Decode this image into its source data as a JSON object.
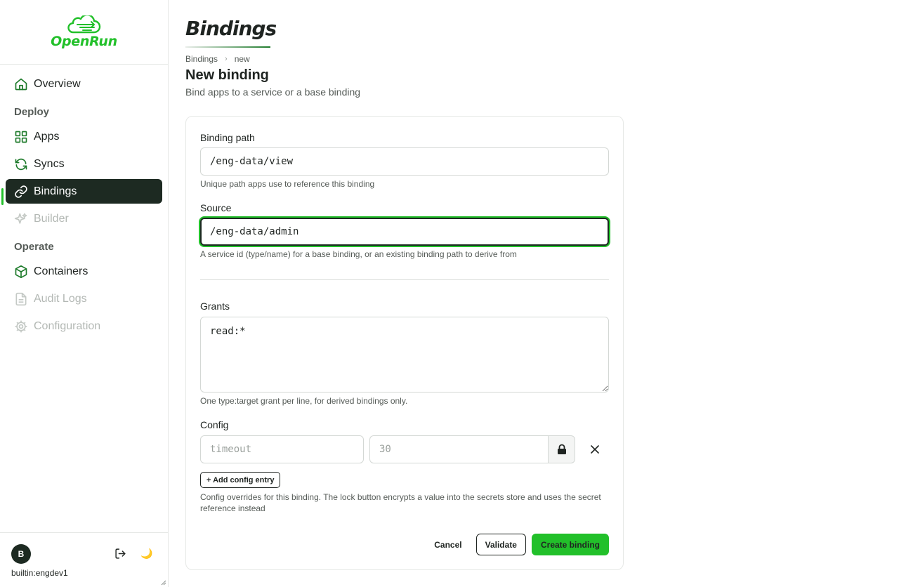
{
  "app": {
    "name": "OpenRun",
    "accent": "#22c02a",
    "dark": "#1d2a22"
  },
  "sidebar": {
    "items": [
      {
        "label": "Overview",
        "icon": "home-icon",
        "state": "normal"
      },
      {
        "label": "Apps",
        "icon": "grid-icon",
        "state": "normal"
      },
      {
        "label": "Syncs",
        "icon": "refresh-icon",
        "state": "normal"
      },
      {
        "label": "Bindings",
        "icon": "link-icon",
        "state": "active"
      },
      {
        "label": "Builder",
        "icon": "sparkle-icon",
        "state": "disabled"
      },
      {
        "label": "Containers",
        "icon": "cube-icon",
        "state": "normal"
      },
      {
        "label": "Audit Logs",
        "icon": "document-icon",
        "state": "disabled"
      },
      {
        "label": "Configuration",
        "icon": "gear-icon",
        "state": "disabled"
      }
    ],
    "sections": {
      "deploy": "Deploy",
      "operate": "Operate"
    },
    "user": {
      "initial": "B",
      "name": "builtin:engdev1"
    },
    "theme_icon": "🌙"
  },
  "header": {
    "heading": "Bindings",
    "breadcrumb": [
      "Bindings",
      "new"
    ],
    "title": "New binding",
    "subtitle": "Bind apps to a service or a base binding"
  },
  "form": {
    "binding_path": {
      "label": "Binding path",
      "value": "/eng-data/view",
      "help": "Unique path apps use to reference this binding"
    },
    "source": {
      "label": "Source",
      "value": "/eng-data/admin",
      "help": "A service id (type/name) for a base binding, or an existing binding path to derive from"
    },
    "grants": {
      "label": "Grants",
      "value": "read:*",
      "help": "One type:target grant per line, for derived bindings only."
    },
    "config": {
      "label": "Config",
      "key_placeholder": "timeout",
      "value_placeholder": "30",
      "add_label": "+ Add config entry",
      "help": "Config overrides for this binding. The lock button encrypts a value into the secrets store and uses the secret reference instead"
    },
    "actions": {
      "cancel": "Cancel",
      "validate": "Validate",
      "create": "Create binding"
    }
  }
}
